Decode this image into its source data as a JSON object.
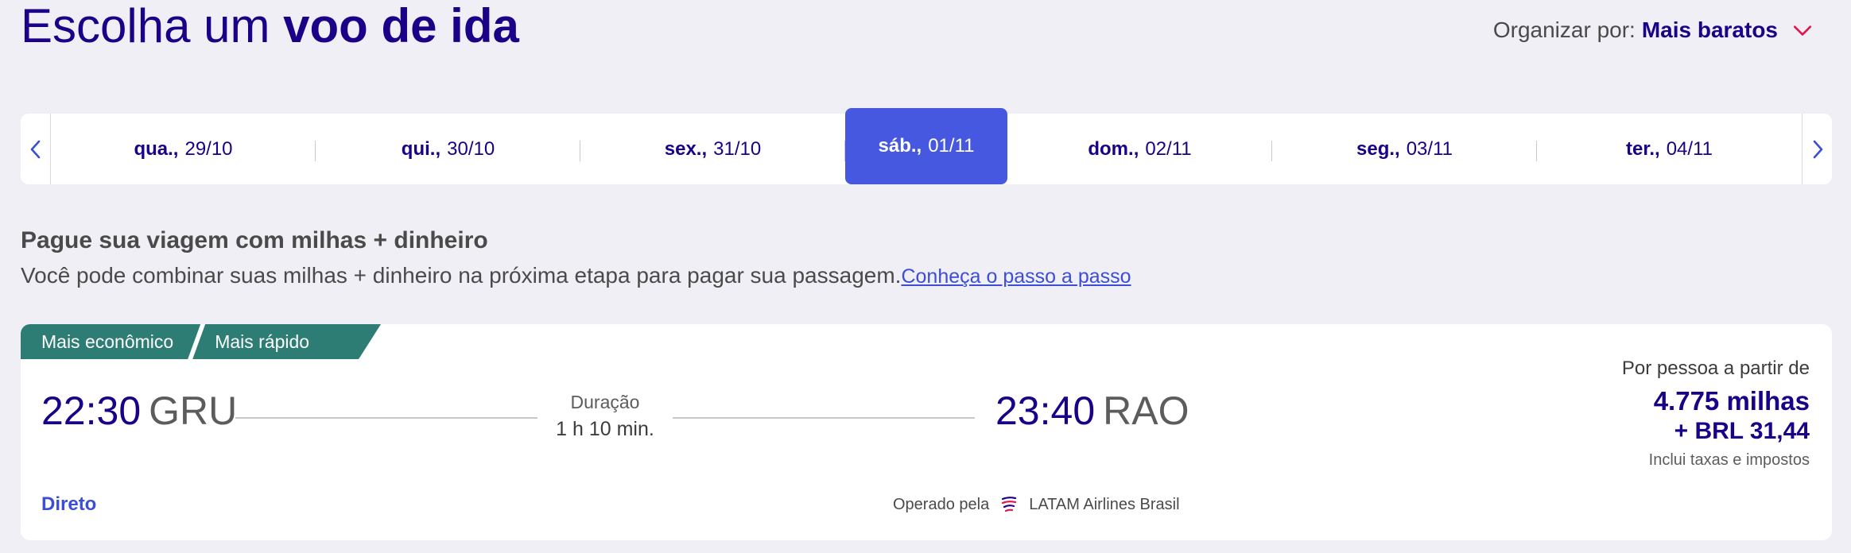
{
  "header": {
    "title_prefix": "Escolha um",
    "title_strong": "voo de ida",
    "sort_label": "Organizar por:",
    "sort_value": "Mais baratos"
  },
  "dates": [
    {
      "dow": "qua.,",
      "date": "29/10",
      "active": false
    },
    {
      "dow": "qui.,",
      "date": "30/10",
      "active": false
    },
    {
      "dow": "sex.,",
      "date": "31/10",
      "active": false
    },
    {
      "dow": "sáb.,",
      "date": "01/11",
      "active": true
    },
    {
      "dow": "dom.,",
      "date": "02/11",
      "active": false
    },
    {
      "dow": "seg.,",
      "date": "03/11",
      "active": false
    },
    {
      "dow": "ter.,",
      "date": "04/11",
      "active": false
    }
  ],
  "miles": {
    "title": "Pague sua viagem com milhas + dinheiro",
    "description": "Você pode combinar suas milhas + dinheiro na próxima etapa para pagar sua passagem.",
    "link": "Conheça o passo a passo"
  },
  "flight": {
    "tags": [
      "Mais econômico",
      "Mais rápido"
    ],
    "departure_time": "22:30",
    "departure_code": "GRU",
    "arrival_time": "23:40",
    "arrival_code": "RAO",
    "duration_label": "Duração",
    "duration_value": "1 h 10 min.",
    "price_from": "Por pessoa a partir de",
    "price_miles": "4.775 milhas",
    "price_cash": "+ BRL 31,44",
    "price_note": "Inclui taxas e impostos",
    "stops": "Direto",
    "operated_by_label": "Operado pela",
    "airline": "LATAM Airlines Brasil"
  },
  "colors": {
    "primary": "#1b0088",
    "accent": "#4658df",
    "tag": "#2e7d75",
    "chevron": "#e8114b"
  },
  "icons": [
    "chevron-down-icon",
    "chevron-left-icon",
    "chevron-right-icon",
    "latam-logo-icon"
  ]
}
